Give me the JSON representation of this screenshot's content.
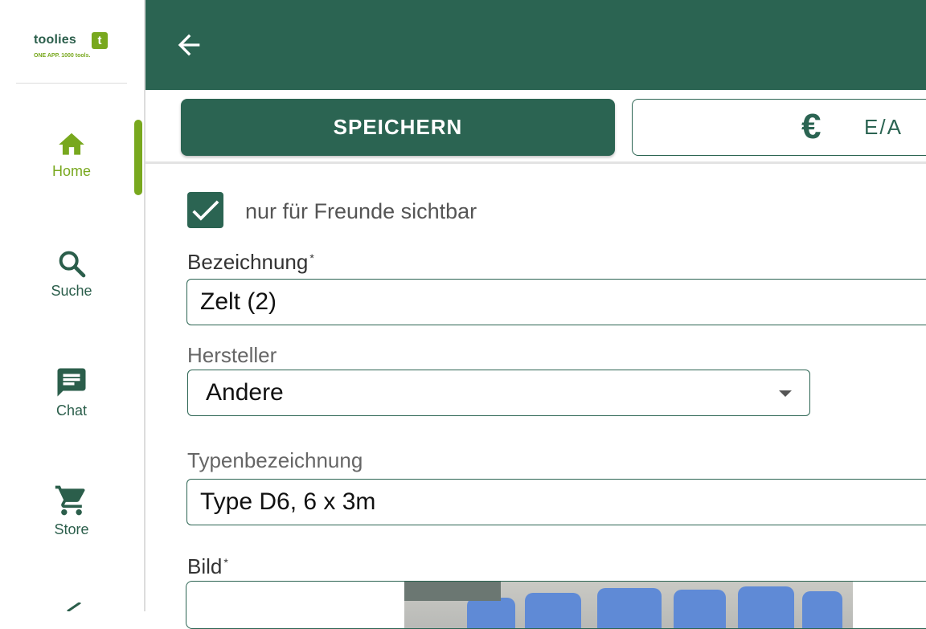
{
  "sidebar": {
    "logo": {
      "name": "toolies",
      "badge": "t",
      "tagline": "ONE APP. 1000 tools."
    },
    "items": [
      {
        "label": "Home",
        "icon": "home-icon",
        "active": true
      },
      {
        "label": "Suche",
        "icon": "search-icon",
        "active": false
      },
      {
        "label": "Chat",
        "icon": "chat-icon",
        "active": false
      },
      {
        "label": "Store",
        "icon": "cart-icon",
        "active": false
      }
    ]
  },
  "topbar": {
    "back_icon": "arrow-left-icon"
  },
  "actions": {
    "save_label": "SPEICHERN",
    "ea_icon": "euro-icon",
    "ea_symbol": "€",
    "ea_label": "E/A"
  },
  "form": {
    "friends_only": {
      "label": "nur für Freunde sichtbar",
      "checked": true
    },
    "bezeichnung": {
      "label": "Bezeichnung",
      "required_mark": "*",
      "value": "Zelt (2)"
    },
    "hersteller": {
      "label": "Hersteller",
      "value": "Andere"
    },
    "typenbezeichnung": {
      "label": "Typenbezeichnung",
      "value": "Type D6, 6 x 3m"
    },
    "bild": {
      "label": "Bild",
      "required_mark": "*"
    }
  },
  "colors": {
    "primary": "#2b6452",
    "accent": "#78a81e",
    "border": "#2b6452",
    "text_muted": "#666666"
  }
}
